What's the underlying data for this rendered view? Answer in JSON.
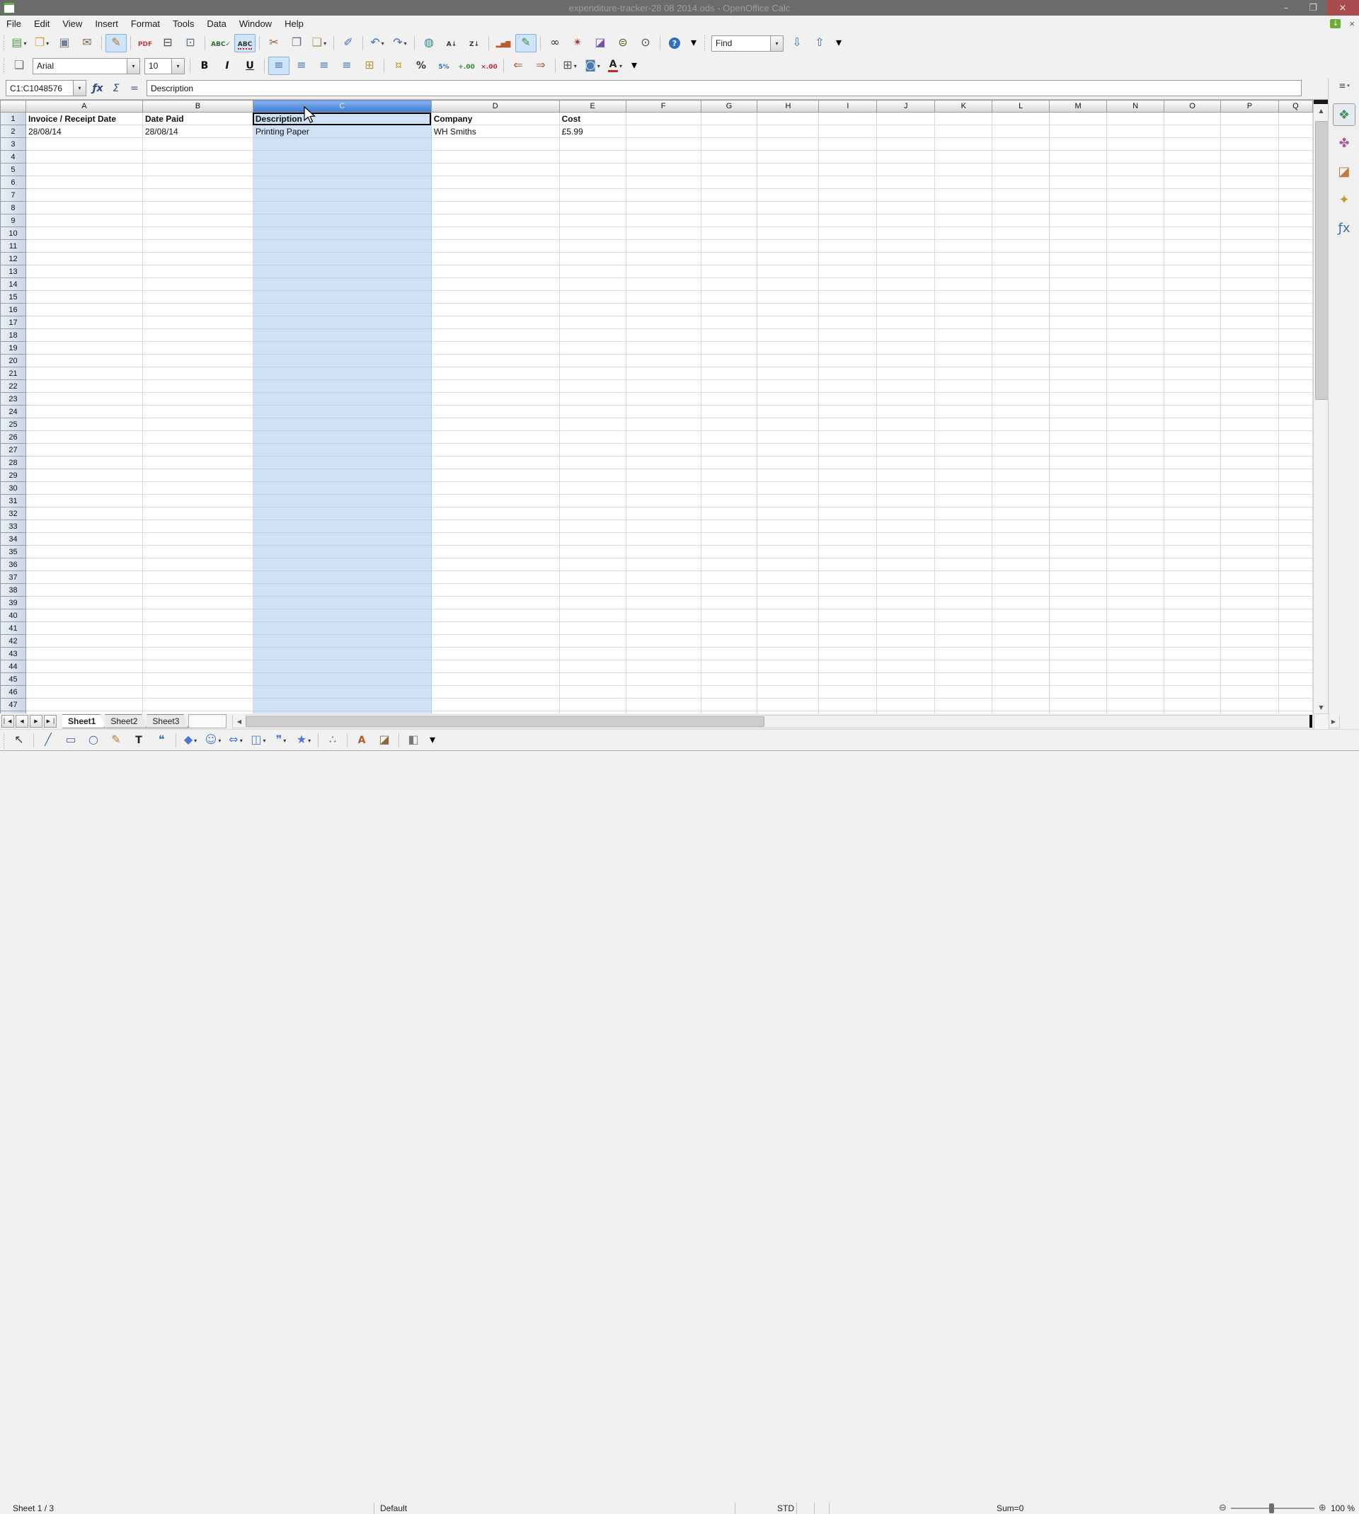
{
  "window": {
    "title": "expenditure-tracker-28 08 2014.ods - OpenOffice Calc",
    "controls": {
      "minimize": "–",
      "restore": "❐",
      "close": "×"
    }
  },
  "menubar": {
    "items": [
      "File",
      "Edit",
      "View",
      "Insert",
      "Format",
      "Tools",
      "Data",
      "Window",
      "Help"
    ],
    "update_glyph": "↓",
    "close_document_glyph": "×"
  },
  "dropdown_glyph": "▾",
  "toolbars": {
    "standard": [
      {
        "name": "new",
        "glyph": "▤",
        "color": "#4f9e45",
        "dropdown": true
      },
      {
        "name": "open",
        "glyph": "❒",
        "color": "#d9a43b",
        "dropdown": true
      },
      {
        "name": "save",
        "glyph": "▣",
        "color": "#6f7f96"
      },
      {
        "name": "email",
        "glyph": "✉",
        "color": "#7a6a52"
      },
      {
        "sep": true
      },
      {
        "name": "edit-mode",
        "glyph": "✎",
        "color": "#b2762a",
        "pressed": true
      },
      {
        "sep": true
      },
      {
        "name": "export-pdf",
        "text": "PDF",
        "color": "#c43b3b"
      },
      {
        "name": "print",
        "glyph": "⊟",
        "color": "#4a4a4a"
      },
      {
        "name": "page-preview",
        "glyph": "⊡",
        "color": "#56708c"
      },
      {
        "sep": true
      },
      {
        "name": "spelling",
        "text": "ABC✓",
        "color": "#2e6e35"
      },
      {
        "name": "autospellcheck",
        "text": "ABC",
        "color": "#333333",
        "pressed": true,
        "underline": "#cc2222"
      },
      {
        "sep": true
      },
      {
        "name": "cut",
        "glyph": "✂",
        "color": "#8a5a2a"
      },
      {
        "name": "copy",
        "glyph": "❐",
        "color": "#5f6f85"
      },
      {
        "name": "paste",
        "glyph": "❏",
        "color": "#b08d4f",
        "dropdown": true
      },
      {
        "sep": true
      },
      {
        "name": "format-paintbrush",
        "glyph": "✐",
        "color": "#3f6fae"
      },
      {
        "sep": true
      },
      {
        "name": "undo",
        "glyph": "↶",
        "color": "#3f6fae",
        "dropdown": true
      },
      {
        "name": "redo",
        "glyph": "↷",
        "color": "#3f6fae",
        "dropdown": true
      },
      {
        "sep": true
      },
      {
        "name": "hyperlink",
        "glyph": "◍",
        "color": "#2e8b8b"
      },
      {
        "name": "sort-ascending",
        "text": "A↓",
        "color": "#333333"
      },
      {
        "name": "sort-descending",
        "text": "Z↓",
        "color": "#333333"
      },
      {
        "sep": true
      },
      {
        "name": "chart",
        "text": "▂▅▇",
        "color": "#b85c2e"
      },
      {
        "name": "draw-functions",
        "glyph": "✎",
        "color": "#3f8f4f",
        "pressed": true
      },
      {
        "sep": true
      },
      {
        "name": "find-replace",
        "glyph": "∞",
        "color": "#2f2f2f"
      },
      {
        "name": "navigator",
        "glyph": "✴",
        "color": "#b03030"
      },
      {
        "name": "gallery",
        "glyph": "◪",
        "color": "#7a4fae"
      },
      {
        "name": "data-sources",
        "glyph": "⊜",
        "color": "#6a5a2a"
      },
      {
        "name": "zoom",
        "glyph": "⊙",
        "color": "#405a7a"
      },
      {
        "sep": true
      },
      {
        "name": "help",
        "glyph": "?",
        "bg": "#2f6fc2",
        "color": "#ffffff"
      },
      {
        "name": "standard-toolbar-options",
        "glyph": "▾",
        "small": true
      }
    ],
    "find": {
      "value": "Find",
      "buttons": [
        {
          "name": "find-down",
          "glyph": "⇩",
          "color": "#3b6fb6"
        },
        {
          "name": "find-up",
          "glyph": "⇧",
          "color": "#3b6fb6"
        },
        {
          "name": "find-toolbar-options",
          "glyph": "▾",
          "small": true
        }
      ]
    },
    "formatting": {
      "font_name": "Arial",
      "font_size": "10",
      "before": [
        {
          "name": "styles-and-formatting",
          "glyph": "❏",
          "color": "#5a6f8a"
        }
      ],
      "after": [
        {
          "sep": true
        },
        {
          "name": "bold",
          "text": "B",
          "color": "#111111",
          "big": true
        },
        {
          "name": "italic",
          "text": "I",
          "color": "#111111",
          "big": true
        },
        {
          "name": "underline",
          "text": "U",
          "color": "#111111",
          "big": true
        },
        {
          "sep": true
        },
        {
          "name": "align-left",
          "glyph": "≡",
          "color": "#3a6fb0",
          "pressed": true
        },
        {
          "name": "align-center",
          "glyph": "≡",
          "color": "#3a6fb0"
        },
        {
          "name": "align-right",
          "glyph": "≡",
          "color": "#3a6fb0"
        },
        {
          "name": "align-justified",
          "glyph": "≡",
          "color": "#3a6fb0"
        },
        {
          "name": "merge-cells",
          "glyph": "⊞",
          "color": "#b59a3a"
        },
        {
          "sep": true
        },
        {
          "name": "number-format-currency",
          "glyph": "¤",
          "color": "#c9a227"
        },
        {
          "name": "number-format-percent",
          "text": "%",
          "color": "#333333",
          "big": true
        },
        {
          "name": "number-format-standard",
          "text": "5%",
          "color": "#3a6fb0"
        },
        {
          "name": "number-format-add-decimal",
          "text": "+.00",
          "color": "#2e8b2e"
        },
        {
          "name": "number-format-delete-decimal",
          "text": "×.00",
          "color": "#c03030"
        },
        {
          "sep": true
        },
        {
          "name": "decrease-indent",
          "glyph": "⇐",
          "color": "#b2622d"
        },
        {
          "name": "increase-indent",
          "glyph": "⇒",
          "color": "#b2622d"
        },
        {
          "sep": true
        },
        {
          "name": "borders",
          "glyph": "⊞",
          "color": "#555555",
          "dropdown": true
        },
        {
          "name": "background-color",
          "glyph": "◙",
          "color": "#4a7ab0",
          "dropdown": true
        },
        {
          "name": "font-color",
          "text": "A",
          "color": "#222222",
          "big": true,
          "bar": "#cc2222",
          "dropdown": true
        },
        {
          "name": "formatting-toolbar-options",
          "glyph": "▾",
          "small": true
        }
      ]
    },
    "drawing": [
      {
        "name": "select",
        "glyph": "↖",
        "color": "#333333"
      },
      {
        "sep": true
      },
      {
        "name": "line",
        "glyph": "╱",
        "color": "#3a6fb0"
      },
      {
        "name": "rectangle",
        "glyph": "▭",
        "color": "#3a6fb0"
      },
      {
        "name": "ellipse",
        "glyph": "○",
        "color": "#3a6fb0"
      },
      {
        "name": "freeform-line",
        "glyph": "✎",
        "color": "#c07a2a"
      },
      {
        "name": "text-box",
        "text": "T",
        "color": "#222222",
        "big": true
      },
      {
        "name": "callout",
        "glyph": "❝",
        "color": "#3a6fb0"
      },
      {
        "sep": true
      },
      {
        "name": "basic-shapes",
        "glyph": "◆",
        "color": "#4a7ad0",
        "dropdown": true
      },
      {
        "name": "symbol-shapes",
        "glyph": "☺",
        "color": "#4a7ad0",
        "dropdown": true
      },
      {
        "name": "block-arrows",
        "glyph": "⇔",
        "color": "#4a7ad0",
        "dropdown": true
      },
      {
        "name": "flowchart",
        "glyph": "◫",
        "color": "#4a7ad0",
        "dropdown": true
      },
      {
        "name": "callouts",
        "glyph": "❞",
        "color": "#4a7ad0",
        "dropdown": true
      },
      {
        "name": "stars",
        "glyph": "★",
        "color": "#4a7ad0",
        "dropdown": true
      },
      {
        "sep": true
      },
      {
        "name": "points",
        "glyph": "∴",
        "color": "#666666"
      },
      {
        "sep": true
      },
      {
        "name": "fontwork-gallery",
        "text": "A",
        "color": "#b05a2a",
        "big": true
      },
      {
        "name": "from-file",
        "glyph": "◪",
        "color": "#8a6a3a"
      },
      {
        "sep": true
      },
      {
        "name": "extrusion",
        "glyph": "◧",
        "color": "#7a7a7a"
      },
      {
        "name": "drawing-toolbar-options",
        "glyph": "▾",
        "small": true
      }
    ]
  },
  "formula_bar": {
    "name_box": "C1:C1048576",
    "function_wizard": "ƒx",
    "sum": "Σ",
    "function": "=",
    "input": "Description"
  },
  "grid": {
    "columns": [
      [
        "A",
        165
      ],
      [
        "B",
        156
      ],
      [
        "C",
        252
      ],
      [
        "D",
        181
      ],
      [
        "E",
        94
      ],
      [
        "F",
        106
      ],
      [
        "G",
        80
      ],
      [
        "H",
        87
      ],
      [
        "I",
        82
      ],
      [
        "J",
        82
      ],
      [
        "K",
        81
      ],
      [
        "L",
        81
      ],
      [
        "M",
        81
      ],
      [
        "N",
        81
      ],
      [
        "O",
        80
      ],
      [
        "P",
        82
      ],
      [
        "Q",
        48
      ]
    ],
    "visible_rows": 50,
    "selected_column": "C",
    "selected_cell": "C1",
    "cells": {
      "A1": {
        "text": "Invoice / Receipt Date",
        "bold": true
      },
      "B1": {
        "text": "Date Paid",
        "bold": true
      },
      "C1": {
        "text": "Description",
        "bold": true
      },
      "D1": {
        "text": "Company",
        "bold": true
      },
      "E1": {
        "text": "Cost",
        "bold": true
      },
      "A2": {
        "text": "28/08/14"
      },
      "B2": {
        "text": "28/08/14"
      },
      "C2": {
        "text": "Printing Paper"
      },
      "D2": {
        "text": "WH Smiths"
      },
      "E2": {
        "text": "£5.99"
      }
    }
  },
  "scrollbars": {
    "up": "▲",
    "down": "▼",
    "left": "◀",
    "right": "▶"
  },
  "sheet_navigation": [
    {
      "name": "first-sheet",
      "glyph": "▏◀"
    },
    {
      "name": "previous-sheet",
      "glyph": "◀"
    },
    {
      "name": "next-sheet",
      "glyph": "▶"
    },
    {
      "name": "last-sheet",
      "glyph": "▶▕"
    }
  ],
  "sheet_tabs": {
    "tabs": [
      "Sheet1",
      "Sheet2",
      "Sheet3"
    ],
    "active_tab": "Sheet1"
  },
  "sidebar": {
    "settings_glyph": "≡",
    "tabs": [
      {
        "name": "properties",
        "glyph": "❖",
        "color": "#3f8f5f",
        "active": true
      },
      {
        "name": "styles-and-formatting",
        "glyph": "✤",
        "color": "#b05a9a"
      },
      {
        "name": "gallery",
        "glyph": "◪",
        "color": "#c07a3a"
      },
      {
        "name": "navigator",
        "glyph": "✦",
        "color": "#c09a2a"
      },
      {
        "name": "functions",
        "glyph": "ƒx",
        "color": "#3a6fb0"
      }
    ]
  },
  "status_bar": {
    "sheet_position": "Sheet 1 / 3",
    "page_style": "Default",
    "selection_mode": "STD",
    "sum": "Sum=0",
    "zoom_out": "⊖",
    "zoom_in": "⊕",
    "zoom_level": "100 %"
  }
}
